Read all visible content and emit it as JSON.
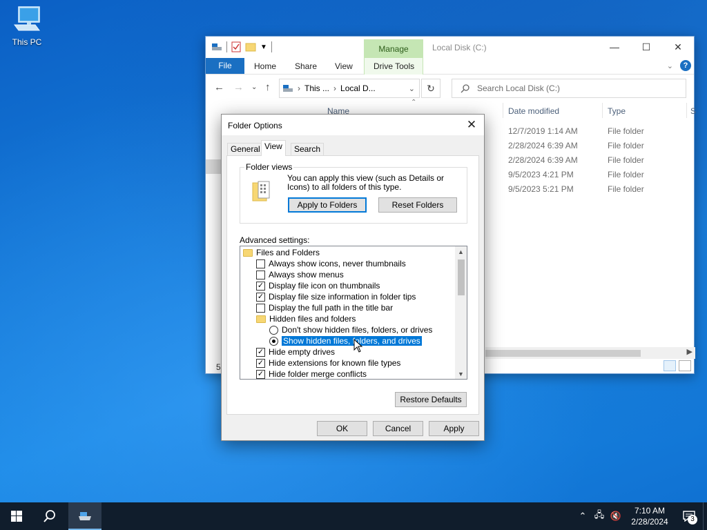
{
  "desktop": {
    "icon_label": "This PC"
  },
  "explorer": {
    "title": "Local Disk (C:)",
    "contextual_tab": "Manage",
    "ribbon_tabs": [
      "File",
      "Home",
      "Share",
      "View",
      "Drive Tools"
    ],
    "address": {
      "crumb1": "This ...",
      "crumb2": "Local D..."
    },
    "search_placeholder": "Search Local Disk (C:)",
    "columns": {
      "name": "Name",
      "date": "Date modified",
      "type": "Type",
      "size": "S"
    },
    "rows": [
      {
        "date": "12/7/2019 1:14 AM",
        "type": "File folder"
      },
      {
        "date": "2/28/2024 6:39 AM",
        "type": "File folder"
      },
      {
        "date": "2/28/2024 6:39 AM",
        "type": "File folder"
      },
      {
        "date": "9/5/2023 4:21 PM",
        "type": "File folder"
      },
      {
        "date": "9/5/2023 5:21 PM",
        "type": "File folder"
      }
    ],
    "status_count": "5"
  },
  "dialog": {
    "title": "Folder Options",
    "tabs": [
      "General",
      "View",
      "Search"
    ],
    "folder_views": {
      "label": "Folder views",
      "text": "You can apply this view (such as Details or Icons) to all folders of this type.",
      "apply_btn": "Apply to Folders",
      "reset_btn": "Reset Folders"
    },
    "advanced_label": "Advanced settings:",
    "tree": [
      {
        "kind": "folder",
        "label": "Files and Folders",
        "indent": 0
      },
      {
        "kind": "check",
        "checked": false,
        "label": "Always show icons, never thumbnails",
        "indent": 1
      },
      {
        "kind": "check",
        "checked": false,
        "label": "Always show menus",
        "indent": 1
      },
      {
        "kind": "check",
        "checked": true,
        "label": "Display file icon on thumbnails",
        "indent": 1
      },
      {
        "kind": "check",
        "checked": true,
        "label": "Display file size information in folder tips",
        "indent": 1
      },
      {
        "kind": "check",
        "checked": false,
        "label": "Display the full path in the title bar",
        "indent": 1
      },
      {
        "kind": "folder",
        "label": "Hidden files and folders",
        "indent": 1
      },
      {
        "kind": "radio",
        "checked": false,
        "label": "Don't show hidden files, folders, or drives",
        "indent": 2
      },
      {
        "kind": "radio",
        "checked": true,
        "selected": true,
        "label": "Show hidden files, folders, and drives",
        "indent": 2
      },
      {
        "kind": "check",
        "checked": true,
        "label": "Hide empty drives",
        "indent": 1
      },
      {
        "kind": "check",
        "checked": true,
        "label": "Hide extensions for known file types",
        "indent": 1
      },
      {
        "kind": "check",
        "checked": true,
        "label": "Hide folder merge conflicts",
        "indent": 1
      }
    ],
    "restore_btn": "Restore Defaults",
    "ok_btn": "OK",
    "cancel_btn": "Cancel",
    "apply_btn": "Apply"
  },
  "taskbar": {
    "time": "7:10 AM",
    "date": "2/28/2024",
    "notification_count": "3"
  }
}
